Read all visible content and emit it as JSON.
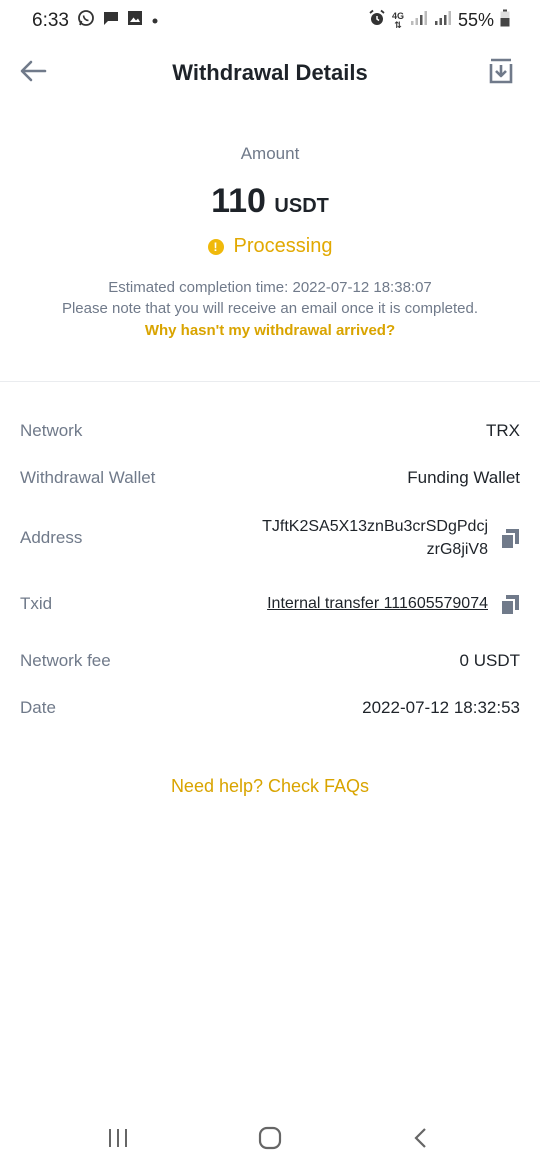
{
  "status_bar": {
    "time": "6:33",
    "battery": "55%",
    "network": "4G",
    "icons": [
      "whatsapp-icon",
      "chat-icon",
      "gallery-icon",
      "dot-icon",
      "alarm-icon",
      "signal-icon",
      "battery-icon"
    ]
  },
  "header": {
    "title": "Withdrawal Details",
    "back_icon": "arrow-left-icon",
    "share_icon": "share-download-icon"
  },
  "summary": {
    "amount_label": "Amount",
    "amount": "110",
    "unit": "USDT",
    "status": "Processing",
    "status_icon": "warning-circle-icon",
    "eta_line1": "Estimated completion time: 2022-07-12 18:38:07",
    "eta_line2": "Please note that you will receive an email once it is completed.",
    "help_link": "Why hasn't my withdrawal arrived?"
  },
  "details": {
    "network": {
      "label": "Network",
      "value": "TRX"
    },
    "wallet": {
      "label": "Withdrawal Wallet",
      "value": "Funding Wallet"
    },
    "address": {
      "label": "Address",
      "line1": "TJftK2SA5X13znBu3crSDgPdcj",
      "line2": "zrG8jiV8"
    },
    "txid": {
      "label": "Txid",
      "value": "Internal transfer 111605579074"
    },
    "fee": {
      "label": "Network fee",
      "value": "0 USDT"
    },
    "date": {
      "label": "Date",
      "value": "2022-07-12 18:32:53"
    }
  },
  "faq_link": "Need help? Check FAQs",
  "colors": {
    "accent": "#f0b90b",
    "accent_text": "#d9a400",
    "muted": "#707a8a",
    "text": "#1e2329"
  }
}
